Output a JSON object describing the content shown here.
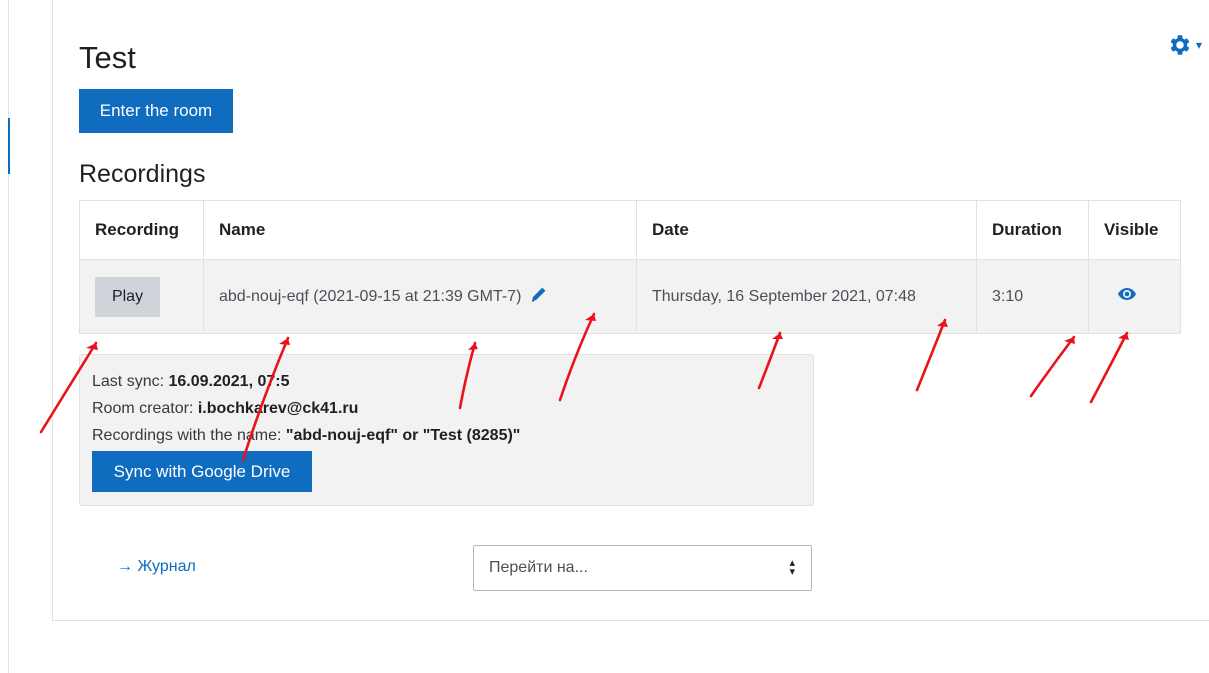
{
  "page": {
    "title": "Test",
    "enter_button": "Enter the room",
    "settings_icon": "gear-icon"
  },
  "recordings": {
    "section_title": "Recordings",
    "columns": [
      "Recording",
      "Name",
      "Date",
      "Duration",
      "Visible"
    ],
    "rows": [
      {
        "play_label": "Play",
        "name": "abd-nouj-eqf (2021-09-15 at 21:39 GMT-7)",
        "date": "Thursday, 16 September 2021, 07:48",
        "duration": "3:10",
        "visible_icon": "eye-icon"
      }
    ]
  },
  "info": {
    "last_sync_label": "Last sync: ",
    "last_sync_value": "16.09.2021, 07:5",
    "creator_label": "Room creator: ",
    "creator_value": "i.bochkarev@ck41.ru",
    "names_label": "Recordings with the name: ",
    "names_value": "\"abd-nouj-eqf\" or \"Test (8285)\"",
    "sync_button": "Sync with Google Drive"
  },
  "footer": {
    "journal_link": "→ Журнал",
    "jump_placeholder": "Перейти на..."
  },
  "colors": {
    "primary": "#0f6cbf",
    "annotation_arrow": "#e8141b"
  }
}
